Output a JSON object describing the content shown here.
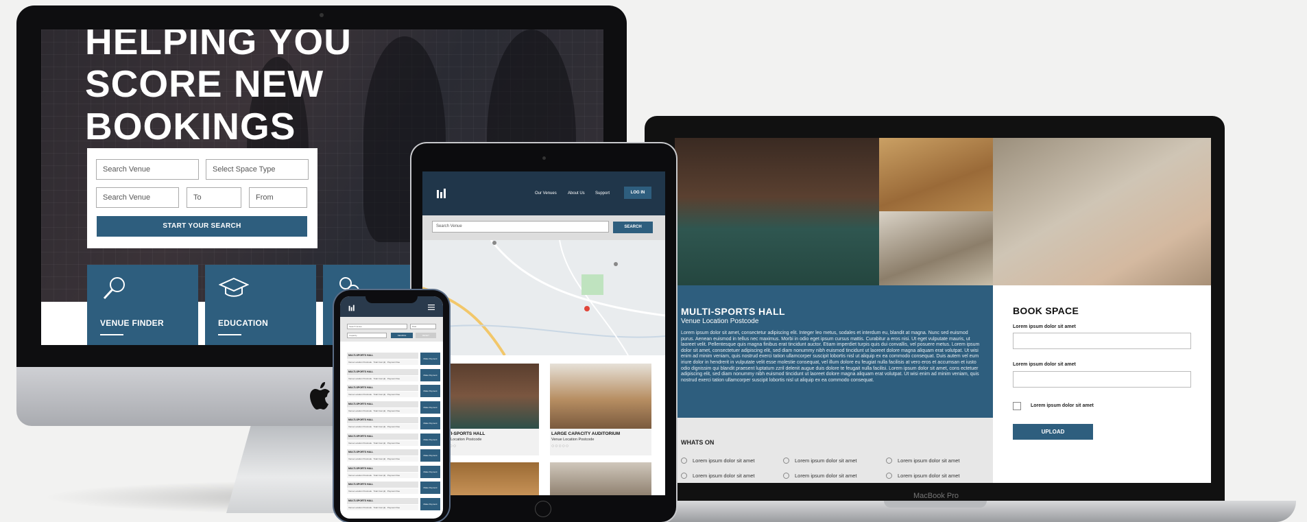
{
  "colors": {
    "brand_blue": "#2e5e7e",
    "nav_dark": "#20364a"
  },
  "imac": {
    "hero_title": [
      "HELPING YOU",
      "SCORE NEW",
      "BOOKINGS"
    ],
    "search": {
      "venue_1": "Search Venue",
      "space_type": "Select Space Type",
      "venue_2": "Search Venue",
      "to": "To",
      "from": "From",
      "button": "START YOUR SEARCH"
    },
    "tiles": [
      {
        "label": "VENUE FINDER",
        "icon": "magnifier-icon"
      },
      {
        "label": "EDUCATION",
        "icon": "graduation-cap-icon"
      },
      {
        "label": "",
        "icon": "gear-icon"
      }
    ]
  },
  "macbook": {
    "brand_label": "MacBook Pro",
    "venue_title": "MULTI-SPORTS HALL",
    "venue_subtitle": "Venue Location Postcode",
    "description": "Lorem ipsum dolor sit amet, consectetur adipiscing elit. Integer leo metus, sodales et interdum eu, blandit at magna. Nunc sed euismod purus. Aenean euismod in tellus nec maximus. Morbi in odio eget ipsum cursus mattis. Curabitur a eros nisi. Ut eget vulputate mauris, ut laoreet velit. Pellentesque quis magna finibus erat tincidunt auctor. Etiam imperdiet turpis quis dui convallis, vel posuere metus. Lorem ipsum dolor sit amet, consectetuer adipiscing elit, sed diam nonummy nibh euismod tincidunt ut laoreet dolore magna aliquam erat volutpat. Ut wisi enim ad minim veniam, quis nostrud exerci tation ullamcorper suscipit lobortis nisl ut aliquip ex ea commodo consequat. Duis autem vel eum iriure dolor in hendrerit in vulputate velit esse molestie consequat, vel illum dolore eu feugiat nulla facilisis at vero eros et accumsan et iusto odio dignissim qui blandit praesent luptatum zzril delenit augue duis dolore te feugait nulla facilisi. Lorem ipsum dolor sit amet, cons ectetuer adipiscing elit, sed diam nonummy nibh euismod tincidunt ut laoreet dolore magna aliquam erat volutpat. Ut wisi enim ad minim veniam, quis nostrud exerci tation ullamcorper suscipit lobortis nisl ut aliquip ex ea commodo consequat.",
    "whats_on_title": "WHATS ON",
    "whats_on_items": [
      "Lorem ipsum dolor sit amet",
      "Lorem ipsum dolor sit amet",
      "Lorem ipsum dolor sit amet",
      "Lorem ipsum dolor sit amet",
      "Lorem ipsum dolor sit amet",
      "Lorem ipsum dolor sit amet"
    ],
    "book": {
      "title": "BOOK SPACE",
      "field1_label": "Lorem ipsum dolor sit amet",
      "field2_label": "Lorem ipsum dolor sit amet",
      "checkbox_label": "Lorem ipsum dolor sit amet",
      "button": "UPLOAD"
    }
  },
  "ipad": {
    "nav": [
      "Our Venues",
      "About Us",
      "Support"
    ],
    "login": "LOG IN",
    "search_placeholder": "Search Venue",
    "search_button": "SEARCH",
    "cards": [
      {
        "title": "MULTI-SPORTS HALL",
        "subtitle": "Venue Location Postcode",
        "stars": "○○○○○"
      },
      {
        "title": "LARGE CAPACITY AUDITORIUM",
        "subtitle": "Venue Location Postcode",
        "stars": "○○○○○"
      }
    ]
  },
  "iphone": {
    "search_1": "Search Venue",
    "date": "Date",
    "capacity": "Capacity",
    "search_button": "SEARCH",
    "reset_button": "RESET",
    "row_title": "MULTI-SPORTS HALL",
    "row_sub": [
      "Venue Location Postcode",
      "Total Cost (£)",
      "Payment Due"
    ],
    "row_button": "Make Payment",
    "row_count": 10
  }
}
